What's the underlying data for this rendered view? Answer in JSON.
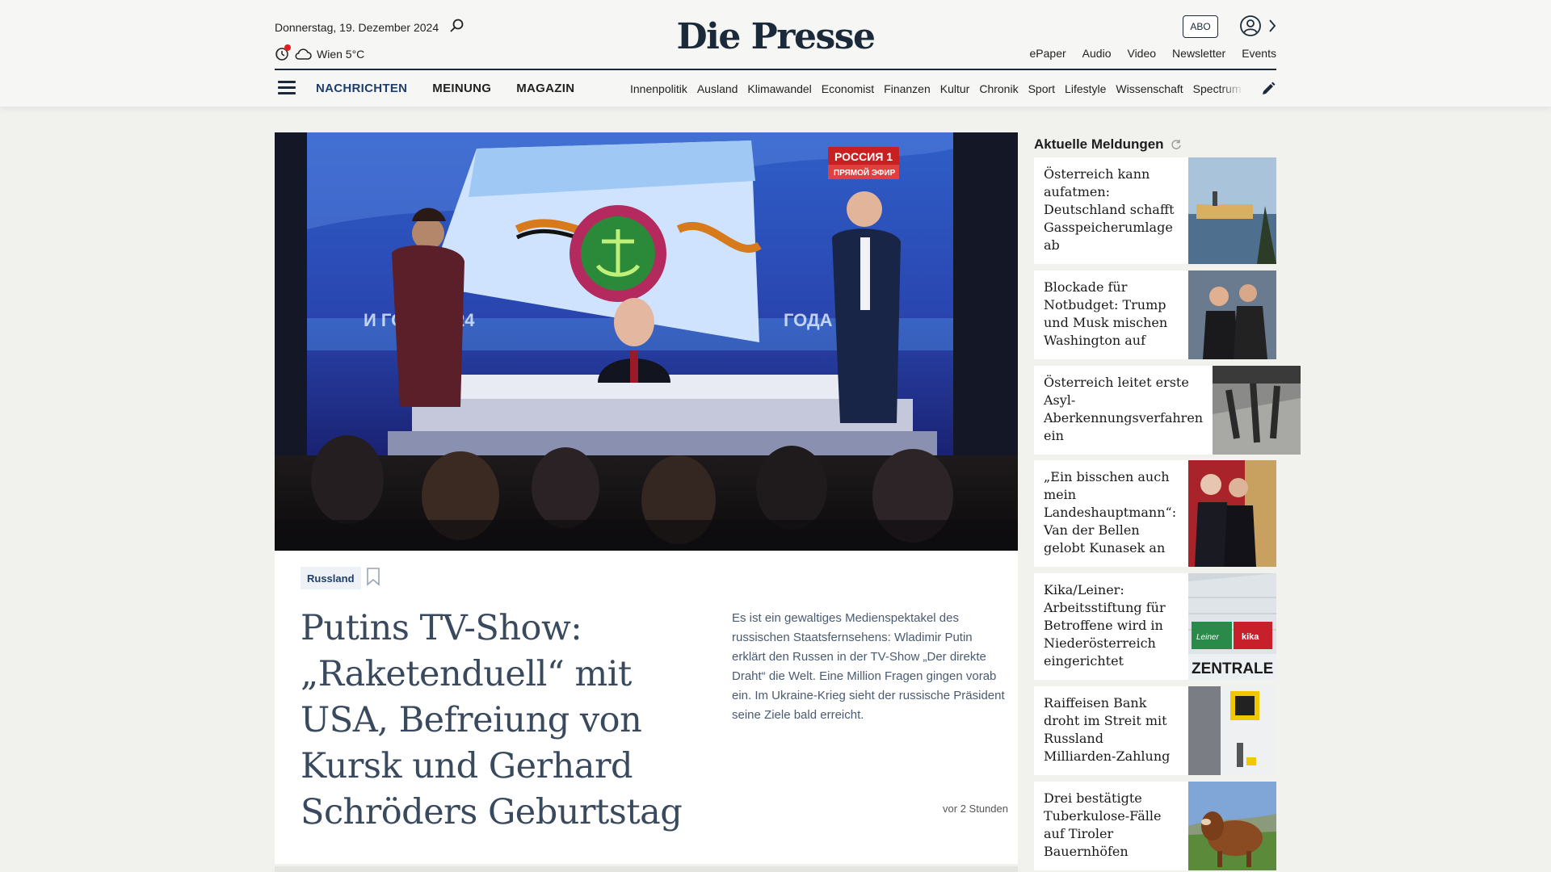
{
  "header": {
    "date": "Donnerstag, 19. Dezember 2024",
    "weather": "Wien 5°C",
    "logo": "Die Presse",
    "abo_label": "ABO",
    "top_links": [
      "ePaper",
      "Audio",
      "Video",
      "Newsletter",
      "Events"
    ],
    "main_nav": [
      "NACHRICHTEN",
      "MEINUNG",
      "MAGAZIN"
    ],
    "sub_nav": [
      "Innenpolitik",
      "Ausland",
      "Klimawandel",
      "Economist",
      "Finanzen",
      "Kultur",
      "Chronik",
      "Sport",
      "Lifestyle",
      "Wissenschaft",
      "Spectrum"
    ]
  },
  "hero": {
    "tag": "Russland",
    "headline": "Putins TV-Show: „Raketenduell“ mit USA, Befreiung von Kursk und Gerhard Schröders Geburtstag",
    "lede": "Es ist ein gewaltiges Medienspektakel des russischen Staatsfernsehens: Wladimir Putin erklärt den Russen in der TV-Show „Der direkte Draht“ die Welt. Eine Million Fragen gingen vorab ein. Im Ukraine-Krieg sieht der russische Präsident seine Ziele bald erreicht.",
    "time": "vor 2 Stunden",
    "image_text": {
      "channel": "РОССИЯ 1",
      "live": "ПРЯМОЙ ЭФИР",
      "year_left": "И ГОДА 2024",
      "year_right": "ГОДА 2024"
    }
  },
  "sidebar": {
    "title": "Aktuelle Meldungen",
    "items": [
      "Österreich kann aufatmen: Deutschland schafft Gasspeicherumlage ab",
      "Blockade für Notbudget: Trump und Musk mischen Washington auf",
      "Österreich leitet erste Asyl-Aberkennungsverfahren ein",
      "„Ein bisschen auch mein Landeshauptmann“: Van der Bellen gelobt Kunasek an",
      "Kika/Leiner: Arbeitsstiftung für Betroffene wird in Niederösterreich eingerichtet",
      "Raiffeisen Bank droht im Streit mit Russland Milliarden-Zahlung",
      "Drei bestätigte Tuberkulose-Fälle auf Tiroler Bauernhöfen"
    ],
    "thumb_text": {
      "kika": "kika",
      "leiner": "Leiner",
      "zentrale": "ZENTRALE"
    }
  },
  "colors": {
    "brand_navy": "#1a2a3a",
    "nav_active": "#1f3f6b",
    "headline": "#3a4a5e",
    "alert_red": "#e11d1d"
  },
  "icons": [
    "search-icon",
    "moon-icon",
    "cloud-icon",
    "user-icon",
    "chevron-right-icon",
    "menu-icon",
    "pencil-icon",
    "bookmark-icon",
    "refresh-icon"
  ]
}
